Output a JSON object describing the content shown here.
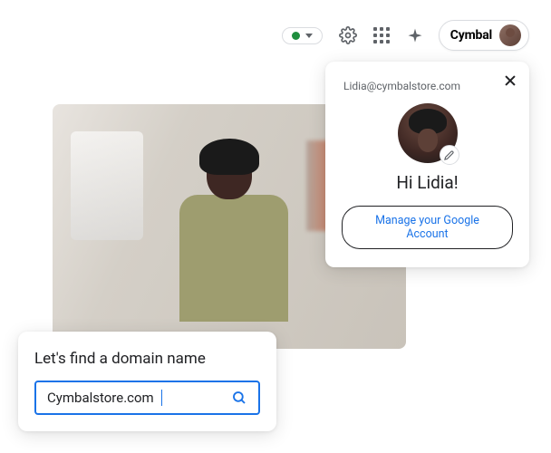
{
  "toolbar": {
    "brand_name": "Cymbal",
    "status": "active"
  },
  "account": {
    "email": "Lidia@cymbalstore.com",
    "greeting": "Hi Lidia!",
    "manage_button": "Manage your Google Account"
  },
  "domain_search": {
    "title": "Let's find a domain name",
    "input_value": "Cymbalstore.com"
  },
  "colors": {
    "primary_blue": "#1a73e8",
    "text_dark": "#202124",
    "text_muted": "#5f6368",
    "green": "#1e8e3e"
  }
}
